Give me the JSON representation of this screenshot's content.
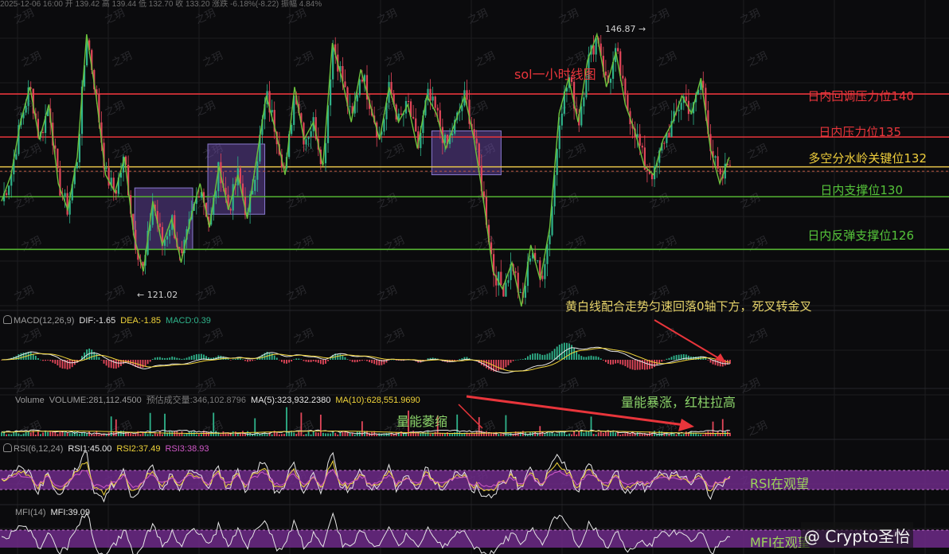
{
  "chart_data": {
    "type": "line",
    "title": "sol一小时线图",
    "series_name": "",
    "price_range": [
      116,
      150
    ],
    "price_path": [
      128,
      131,
      137,
      141,
      135,
      139,
      130,
      127,
      133,
      147,
      140,
      131,
      129,
      133,
      124,
      120,
      128,
      123,
      126,
      121,
      126,
      130,
      125,
      132,
      127,
      131,
      126,
      133,
      140,
      136,
      131,
      141,
      135,
      137,
      132,
      146,
      142,
      137,
      143,
      139,
      135,
      141,
      137,
      139,
      134,
      140,
      138,
      134,
      137,
      140,
      135,
      128,
      120,
      118,
      121,
      116,
      123,
      119,
      125,
      138,
      142,
      137,
      144,
      147,
      141,
      145,
      139,
      136,
      132,
      131,
      135,
      137,
      140,
      138,
      142,
      134,
      130,
      133
    ],
    "high_label": "146.87",
    "low_label": "121.02",
    "levels": [
      {
        "label": "日内回调压力位140",
        "value": 140.2,
        "color": "#e8353b",
        "label_color": "#e8353b"
      },
      {
        "label": "日内压力位135",
        "value": 135.3,
        "color": "#e8353b",
        "label_color": "#e8353b"
      },
      {
        "label": "多空分水岭关键位132",
        "value": 131.9,
        "color": "#e8c64a",
        "label_color": "#f0cf3c"
      },
      {
        "label": "日内支撑位130",
        "value": 128.5,
        "color": "#55b532",
        "label_color": "#55c43a"
      },
      {
        "label": "日内反弹支撑位126",
        "value": 122.5,
        "color": "#55b532",
        "label_color": "#55c43a"
      }
    ],
    "boxes": [
      {
        "x0": 0.142,
        "x1": 0.203,
        "p_top": 129.5,
        "p_bot": 122.5
      },
      {
        "x0": 0.219,
        "x1": 0.279,
        "p_top": 134.5,
        "p_bot": 126.5
      },
      {
        "x0": 0.455,
        "x1": 0.528,
        "p_top": 136.0,
        "p_bot": 131.0
      }
    ],
    "annotations": [
      {
        "text": "黄白线配合走势匀速回落0轴下方，死叉转金叉",
        "color": "#e6d36a"
      },
      {
        "text": "量能暴涨，红柱拉高",
        "color": "#8bd36a"
      },
      {
        "text": "量能萎缩",
        "color": "#8bd36a"
      },
      {
        "text": "RSI在观望",
        "color": "#9bd55a"
      },
      {
        "text": "MFI在观望",
        "color": "#9bd55a"
      }
    ],
    "watermark": "之玥",
    "signature": "@ Crypto圣怡",
    "header_text": "2025-12-06 16:00  开 139.42  高 139.44  低 132.70  收 133.20  涨跌 -6.18%(-8.22)  振幅 4.84%"
  },
  "indicators": {
    "macd": {
      "name": "MACD(12,26,9)",
      "dif": "DIF:-1.65",
      "dea": "DEA:-1.85",
      "macd": "MACD:0.39"
    },
    "volume": {
      "name": "Volume",
      "vol": "VOLUME:281,112.4500",
      "est": "预估成交量:346,102.8796",
      "ma5": "MA(5):323,932.2380",
      "ma10": "MA(10):628,551.9690"
    },
    "rsi": {
      "name": "RSI(6,12,24)",
      "rsi1": "RSI1:45.00",
      "rsi2": "RSI2:37.49",
      "rsi3": "RSI3:38.93"
    },
    "mfi": {
      "name": "MFI(14)",
      "mfi": "MFI:39.09"
    }
  },
  "colors": {
    "up": "#2fb38b",
    "down": "#e3475a",
    "dif": "#e8e8e8",
    "dea": "#f0d43a",
    "rsi_band": "#6d2a88"
  }
}
